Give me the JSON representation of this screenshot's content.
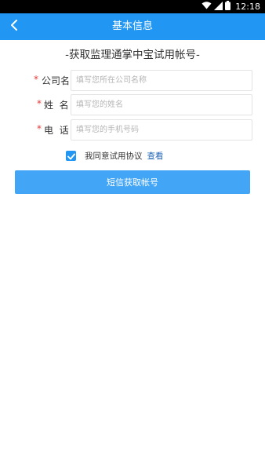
{
  "status_bar": {
    "time": "12:18",
    "icons": [
      "wifi-icon",
      "signal-icon",
      "battery-icon"
    ]
  },
  "app_bar": {
    "title": "基本信息",
    "back_icon": "chevron-left-icon"
  },
  "form": {
    "title": "-获取监理通掌中宝试用帐号-",
    "required_mark": "*",
    "fields": [
      {
        "label": "公司名",
        "placeholder": "填写您所在公司名称",
        "value": ""
      },
      {
        "label": "姓  名",
        "placeholder": "填写您的姓名",
        "value": ""
      },
      {
        "label": "电  话",
        "placeholder": "填写您的手机号码",
        "value": ""
      }
    ],
    "agreement": {
      "checked": true,
      "text": "我同意试用协议",
      "link": "查看"
    },
    "submit_label": "短信获取帐号"
  },
  "colors": {
    "app_bar": "#2196f3",
    "button": "#42a5f5",
    "required": "#e53935",
    "link": "#1e63b5"
  }
}
